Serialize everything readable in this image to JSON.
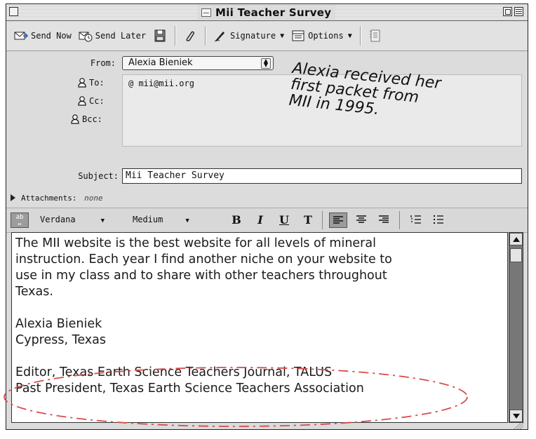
{
  "window": {
    "title": "Mii Teacher Survey"
  },
  "toolbar": {
    "send_now": "Send Now",
    "send_later": "Send Later",
    "signature": "Signature",
    "options": "Options"
  },
  "header": {
    "from_label": "From:",
    "from_value": "Alexia Bieniek",
    "to_label": "To:",
    "to_value": "mii@mii.org",
    "cc_label": "Cc:",
    "bcc_label": "Bcc:",
    "subject_label": "Subject:",
    "subject_value": "Mii Teacher Survey",
    "attachments_label": "Attachments:",
    "attachments_value": "none"
  },
  "format_bar": {
    "font": "Verdana",
    "size": "Medium",
    "bold": "B",
    "italic": "I",
    "underline": "U",
    "teletype": "T"
  },
  "message": {
    "line1": "The MII website is the best website for all levels of mineral",
    "line2": "instruction.  Each year I find another niche on your website to",
    "line3": "use in my class and to share with other teachers throughout",
    "line4": "Texas.",
    "sig_name": "Alexia Bieniek",
    "sig_location": "Cypress, Texas",
    "sig_title1": "Editor, Texas Earth Science Teachers Journal, TALUS",
    "sig_title2": "Past President, Texas Earth Science Teachers Association"
  },
  "annotation": {
    "line1": "Alexia received her",
    "line2": "first packet from",
    "line3": "MII in 1995."
  },
  "colors": {
    "ellipse": "#d94a4a"
  }
}
